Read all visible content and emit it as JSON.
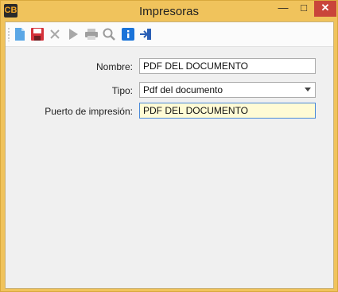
{
  "app": {
    "icon_text": "CB",
    "title": "Impresoras"
  },
  "window_controls": {
    "minimize": "—",
    "maximize": "□",
    "close": "✕"
  },
  "toolbar": {
    "buttons": [
      {
        "name": "new-icon"
      },
      {
        "name": "save-icon"
      },
      {
        "name": "delete-icon"
      },
      {
        "name": "run-icon"
      },
      {
        "name": "print-icon"
      },
      {
        "name": "search-icon"
      },
      {
        "name": "info-icon"
      },
      {
        "name": "exit-icon"
      }
    ]
  },
  "form": {
    "nombre": {
      "label": "Nombre:",
      "value": "PDF DEL DOCUMENTO"
    },
    "tipo": {
      "label": "Tipo:",
      "value": "Pdf del documento"
    },
    "puerto": {
      "label": "Puerto de impresión:",
      "value": "PDF DEL DOCUMENTO"
    }
  },
  "colors": {
    "title_bar": "#f0c35c",
    "close_button": "#c9453a",
    "focus_field": "#fffbd5"
  }
}
